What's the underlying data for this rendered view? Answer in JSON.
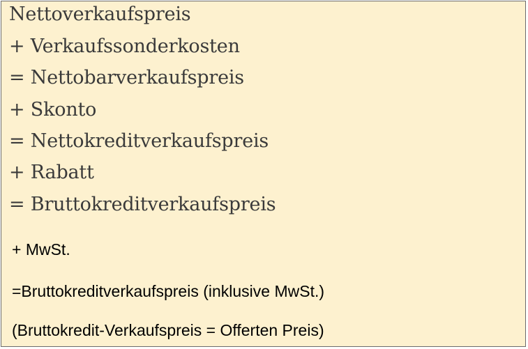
{
  "calculation_box": {
    "serif_lines": [
      "Nettoverkaufspreis",
      "+ Verkaufssonderkosten",
      "= Nettobarverkaufspreis",
      "+ Skonto",
      "= Nettokreditverkaufspreis",
      "+ Rabatt",
      "= Bruttokreditverkaufspreis"
    ],
    "sans_lines": [
      "+ MwSt.",
      "=Bruttokreditverkaufspreis (inklusive MwSt.)",
      "(Bruttokredit-Verkaufspreis = Offerten Preis)"
    ]
  }
}
